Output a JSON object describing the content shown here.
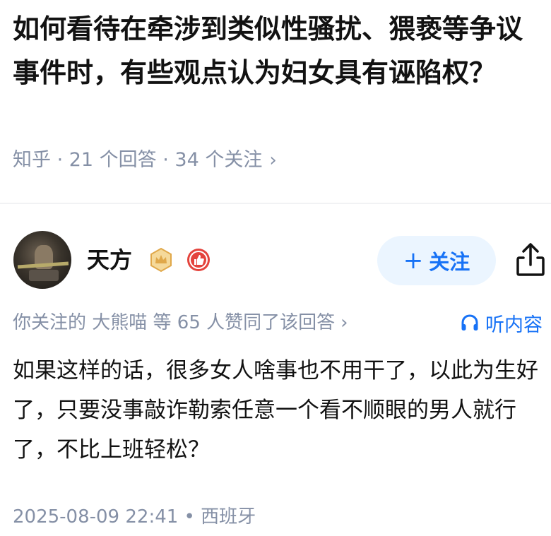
{
  "question": {
    "title": "如何看待在牵涉到类似性骚扰、猥亵等争议事件时，有些观点认为妇女具有诬陷权？",
    "meta": "知乎 · 21 个回答 · 34 个关注",
    "meta_chevron": "›"
  },
  "answer": {
    "author": {
      "name": "天方",
      "avatar": "avatar-image",
      "badges": [
        "crown-badge-icon",
        "like-badge-icon"
      ]
    },
    "follow_button": {
      "plus": "+",
      "label": "关注"
    },
    "share_icon": "share-icon",
    "social_proof": "你关注的 大熊喵 等 65 人赞同了该回答",
    "social_proof_chevron": "›",
    "listen_label": "听内容",
    "content": "如果这样的话，很多女人啥事也不用干了，以此为生好了，只要没事敲诈勒索任意一个看不顺眼的男人就行了，不比上班轻松？",
    "footer": "2025-08-09 22:41 • 西班牙"
  },
  "colors": {
    "accent": "#1772f6",
    "follow_bg": "#ebf5ff",
    "muted_text": "#8590a6",
    "badge_gold": "#e0a84a",
    "badge_red": "#e4433c"
  }
}
